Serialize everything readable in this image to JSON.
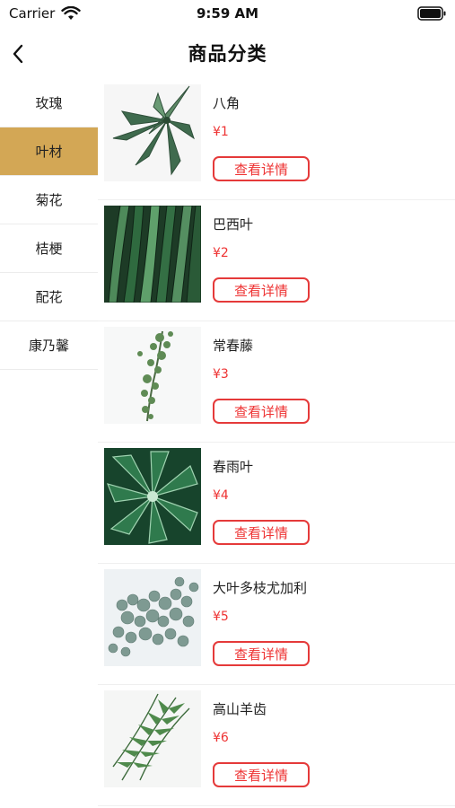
{
  "status_bar": {
    "carrier": "Carrier",
    "time": "9:59 AM"
  },
  "nav": {
    "title": "商品分类",
    "back_icon": "chevron-left-icon"
  },
  "sidebar": {
    "active_index": 1,
    "active_color": "#d3a755",
    "items": [
      {
        "label": "玫瑰"
      },
      {
        "label": "叶材"
      },
      {
        "label": "菊花"
      },
      {
        "label": "桔梗"
      },
      {
        "label": "配花"
      },
      {
        "label": "康乃馨"
      }
    ]
  },
  "products": {
    "button_label": "查看详情",
    "accent_color": "#e33",
    "items": [
      {
        "name": "八角",
        "price": "¥1"
      },
      {
        "name": "巴西叶",
        "price": "¥2"
      },
      {
        "name": "常春藤",
        "price": "¥3"
      },
      {
        "name": "春雨叶",
        "price": "¥4"
      },
      {
        "name": "大叶多枝尤加利",
        "price": "¥5"
      },
      {
        "name": "高山羊齿",
        "price": "¥6"
      }
    ]
  }
}
